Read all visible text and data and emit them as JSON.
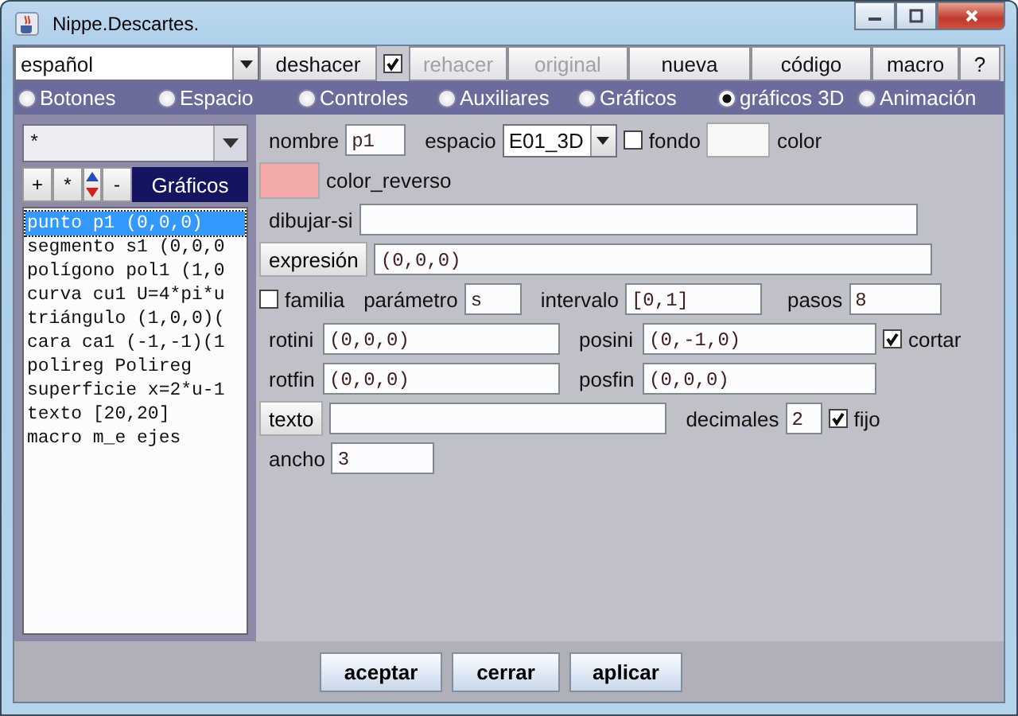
{
  "window": {
    "title": "Nippe.Descartes."
  },
  "toolbar": {
    "language": "español",
    "undo_link": {
      "checked": true
    },
    "buttons": [
      {
        "label": "deshacer",
        "disabled": false
      },
      {
        "label": "rehacer",
        "disabled": true
      },
      {
        "label": "original",
        "disabled": true
      },
      {
        "label": "nueva",
        "disabled": false
      },
      {
        "label": "código",
        "disabled": false
      },
      {
        "label": "macro",
        "disabled": false
      },
      {
        "label": "?",
        "disabled": false
      }
    ]
  },
  "tabs": [
    {
      "label": "Botones",
      "selected": false
    },
    {
      "label": "Espacio",
      "selected": false
    },
    {
      "label": "Controles",
      "selected": false
    },
    {
      "label": "Auxiliares",
      "selected": false
    },
    {
      "label": "Gráficos",
      "selected": false
    },
    {
      "label": "gráficos 3D",
      "selected": true
    },
    {
      "label": "Animación",
      "selected": false
    }
  ],
  "sidebar": {
    "filter": "*",
    "add": "+",
    "duplicate": "*",
    "remove": "-",
    "heading": "Gráficos",
    "items": [
      {
        "label": "punto p1 (0,0,0)",
        "selected": true
      },
      {
        "label": "segmento s1 (0,0,0",
        "selected": false
      },
      {
        "label": "polígono pol1 (1,0",
        "selected": false
      },
      {
        "label": "curva cu1 U=4*pi*u",
        "selected": false
      },
      {
        "label": "triángulo (1,0,0)(",
        "selected": false
      },
      {
        "label": "cara ca1 (-1,-1)(1",
        "selected": false
      },
      {
        "label": "polireg Polireg",
        "selected": false
      },
      {
        "label": "superficie x=2*u-1",
        "selected": false
      },
      {
        "label": "texto [20,20]",
        "selected": false
      },
      {
        "label": "macro m_e ejes",
        "selected": false
      }
    ]
  },
  "form": {
    "nombre": {
      "label": "nombre",
      "value": "p1"
    },
    "espacio": {
      "label": "espacio",
      "value": "E01_3D"
    },
    "fondo": {
      "label": "fondo",
      "checked": false
    },
    "color": {
      "label": "color",
      "color": "#f8f8f8"
    },
    "color_reverso": {
      "label": "color_reverso",
      "color": "#f4aaaa"
    },
    "dibujar_si": {
      "label": "dibujar-si"
    },
    "expresion": {
      "label": "expresión",
      "value": "(0,0,0)"
    },
    "familia": {
      "label": "familia",
      "checked": false
    },
    "parametro": {
      "label": "parámetro",
      "value": "s"
    },
    "intervalo": {
      "label": "intervalo",
      "value": "[0,1]"
    },
    "pasos": {
      "label": "pasos",
      "value": "8"
    },
    "rotini": {
      "label": "rotini",
      "value": "(0,0,0)"
    },
    "posini": {
      "label": "posini",
      "value": "(0,-1,0)"
    },
    "cortar": {
      "label": "cortar",
      "checked": true
    },
    "rotfin": {
      "label": "rotfin",
      "value": "(0,0,0)"
    },
    "posfin": {
      "label": "posfin",
      "value": "(0,0,0)"
    },
    "texto": {
      "label": "texto"
    },
    "decimales": {
      "label": "decimales",
      "value": "2"
    },
    "fijo": {
      "label": "fijo",
      "checked": true
    },
    "ancho": {
      "label": "ancho",
      "value": "3"
    }
  },
  "footer": [
    "aceptar",
    "cerrar",
    "aplicar"
  ]
}
